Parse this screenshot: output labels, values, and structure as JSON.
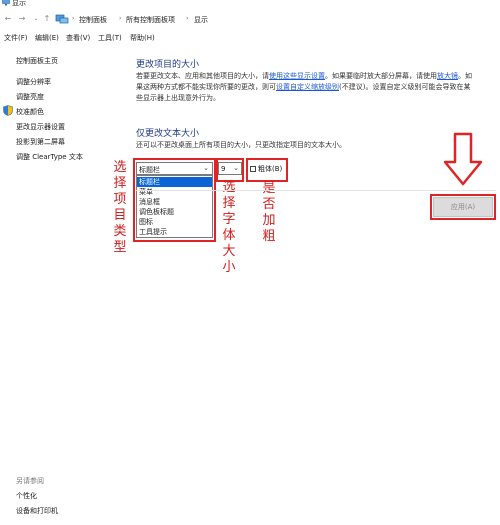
{
  "window": {
    "title": "显示"
  },
  "address": {
    "breadcrumbs": [
      "控制面板",
      "所有控制面板项",
      "显示"
    ]
  },
  "menu": {
    "items": [
      "文件(F)",
      "编辑(E)",
      "查看(V)",
      "工具(T)",
      "帮助(H)"
    ]
  },
  "sidebar": {
    "items": [
      "控制面板主页",
      "调整分辨率",
      "调整亮度",
      "校准颜色",
      "更改显示器设置",
      "投影到第二屏幕",
      "调整 ClearType 文本"
    ],
    "see_also": {
      "heading": "另请参阅",
      "items": [
        "个性化",
        "设备和打印机"
      ]
    }
  },
  "main": {
    "heading1": "更改项目的大小",
    "p1": {
      "line1_a": "若要更改文本、应用和其他项目的大小，请",
      "line1_link": "使用这些显示设置",
      "line1_b": "。如果要临时放大部分屏幕，请使用",
      "line1_link2": "放大镜",
      "line1_c": "。如",
      "line2_a": "果这两种方式都不能实现你所要的更改，则可",
      "line2_link": "设置自定义缩放级别",
      "line2_b": "(不建议)。设置自定义级别可能会导致在某",
      "line3": "些显示器上出现意外行为。"
    },
    "heading2": "仅更改文本大小",
    "p2": "还可以不更改桌面上所有项目的大小，只更改指定项目的文本大小。",
    "item_select": {
      "selected": "标题栏",
      "options": [
        "标题栏",
        "菜单",
        "消息框",
        "调色板标题",
        "图标",
        "工具提示"
      ]
    },
    "size_select": {
      "selected": "9"
    },
    "bold": {
      "label": "粗体(B)"
    },
    "apply": {
      "label": "应用(A)"
    }
  },
  "annotations": {
    "item_type": "选择项目类型",
    "font_size": "选择字体大小",
    "bold": "是否加粗"
  },
  "colors": {
    "annotation_red": "#e02424",
    "heading_blue": "#1e3a8a",
    "link_blue": "#1a56db"
  }
}
